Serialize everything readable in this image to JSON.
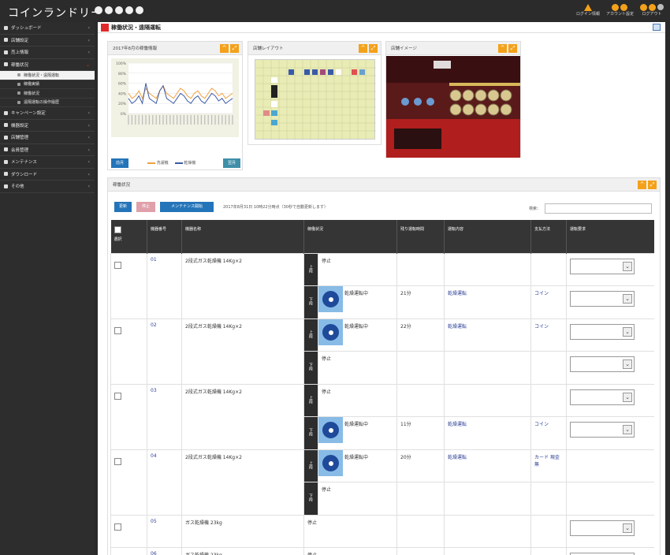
{
  "app": {
    "title": "コインランドリー"
  },
  "top_right": {
    "items": [
      "ログイン情報",
      "アカウント設定",
      "ログアウト"
    ]
  },
  "sidebar": {
    "items": [
      {
        "label": "ダッシュボード"
      },
      {
        "label": "店舗設定"
      },
      {
        "label": "売上情報"
      },
      {
        "label": "稼働状況"
      },
      {
        "label": "キャンペーン設定"
      },
      {
        "label": "機器設定"
      },
      {
        "label": "店舗管理"
      },
      {
        "label": "会員管理"
      },
      {
        "label": "メンテナンス"
      },
      {
        "label": "ダウンロード"
      },
      {
        "label": "その他"
      }
    ],
    "subitems": [
      {
        "label": "稼働状況・遠隔運転"
      },
      {
        "label": "稼働実績"
      },
      {
        "label": "稼働状況"
      },
      {
        "label": "遠隔運転の操作履歴"
      }
    ]
  },
  "page": {
    "title": "稼働状況・遠隔運転"
  },
  "panels": {
    "chart": {
      "title": "2017年8月の稼働情報",
      "btn_left": "前月",
      "btn_right": "翌月",
      "legend": [
        "洗濯機",
        "乾燥機"
      ]
    },
    "layout": {
      "title": "店舗レイアウト"
    },
    "image": {
      "title": "店舗イメージ"
    }
  },
  "status": {
    "title": "稼働状況",
    "btn_update": "更新",
    "btn_stop": "停止",
    "btn_maintenance": "メンテナンス開始",
    "notice": "2017年8月31日 10時22分時点（30秒で自動更新します）",
    "search_label": "検索："
  },
  "table": {
    "headers": [
      "選択",
      "機器番号",
      "機器名称",
      "稼働状況",
      "残り運転時間",
      "運転内容",
      "支払方法",
      "運転要求"
    ],
    "position_labels": {
      "upper": "上段",
      "lower": "下段"
    },
    "rows": [
      {
        "no": "01",
        "name": "2段式ガス乾燥機 14Kg×2",
        "upper": {
          "status": "停止",
          "remaining": "",
          "course": "",
          "payment": ""
        },
        "lower": {
          "status": "乾燥運転中",
          "remaining": "21分",
          "course": "乾燥運転",
          "payment": "コイン"
        }
      },
      {
        "no": "02",
        "name": "2段式ガス乾燥機 14Kg×2",
        "upper": {
          "status": "乾燥運転中",
          "remaining": "22分",
          "course": "乾燥運転",
          "payment": "コイン"
        },
        "lower": {
          "status": "停止",
          "remaining": "",
          "course": "",
          "payment": ""
        }
      },
      {
        "no": "03",
        "name": "2段式ガス乾燥機 14Kg×2",
        "upper": {
          "status": "停止",
          "remaining": "",
          "course": "",
          "payment": ""
        },
        "lower": {
          "status": "乾燥運転中",
          "remaining": "11分",
          "course": "乾燥運転",
          "payment": "コイン"
        }
      },
      {
        "no": "04",
        "name": "2段式ガス乾燥機 14Kg×2",
        "upper": {
          "status": "乾燥運転中",
          "remaining": "20分",
          "course": "乾燥運転",
          "payment": "カード 現金無"
        },
        "lower": {
          "status": "停止",
          "remaining": "",
          "course": "",
          "payment": ""
        }
      },
      {
        "no": "05",
        "name": "ガス乾燥機 23kg",
        "status": "停止"
      },
      {
        "no": "06",
        "name": "ガス乾燥機 23kg",
        "status": "停止"
      }
    ]
  },
  "chart_data": {
    "type": "line",
    "title": "2017年8月の稼働情報",
    "ylim": [
      0,
      100
    ],
    "yticks": [
      "100%",
      "80%",
      "60%",
      "40%",
      "20%",
      "0%"
    ],
    "series": [
      {
        "name": "洗濯機",
        "color": "#f0a040",
        "values": [
          40,
          30,
          35,
          45,
          30,
          50,
          40,
          35,
          30,
          45,
          55,
          40,
          35,
          30,
          40,
          50,
          45,
          35,
          30,
          40,
          45,
          35,
          30,
          40,
          50,
          45,
          35,
          40,
          30,
          35,
          40
        ]
      },
      {
        "name": "乾燥機",
        "color": "#3a5aa8",
        "values": [
          30,
          20,
          25,
          35,
          20,
          60,
          30,
          25,
          20,
          45,
          55,
          30,
          25,
          20,
          30,
          40,
          35,
          25,
          20,
          30,
          35,
          25,
          20,
          30,
          40,
          35,
          25,
          30,
          20,
          25,
          30
        ]
      }
    ]
  }
}
